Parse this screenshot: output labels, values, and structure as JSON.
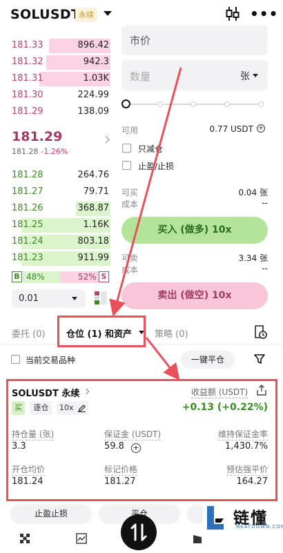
{
  "header": {
    "title": "SOLUSDT",
    "tag": "永续",
    "menu_icon": "more-icon",
    "chart_icon": "candlestick-icon"
  },
  "orderbook": {
    "asks": [
      {
        "price": "181.33",
        "qty": "896.42",
        "depth": 0.62
      },
      {
        "price": "181.32",
        "qty": "942.3",
        "depth": 0.65
      },
      {
        "price": "181.31",
        "qty": "1.03K",
        "depth": 0.72
      },
      {
        "price": "181.30",
        "qty": "224.99",
        "depth": 0.0
      },
      {
        "price": "181.29",
        "qty": "138.09",
        "depth": 0.0
      }
    ],
    "last_price": "181.29",
    "mark_price": "181.28",
    "change": "-1.26%",
    "bids": [
      {
        "price": "181.28",
        "qty": "264.76",
        "depth": 0.0
      },
      {
        "price": "181.27",
        "qty": "79.71",
        "depth": 0.0
      },
      {
        "price": "181.26",
        "qty": "368.87",
        "depth": 0.35
      },
      {
        "price": "181.25",
        "qty": "1.16K",
        "depth": 0.9
      },
      {
        "price": "181.24",
        "qty": "803.18",
        "depth": 0.9
      },
      {
        "price": "181.23",
        "qty": "911.99",
        "depth": 0.9
      }
    ],
    "buy_label": "B",
    "buy_ratio": "48%",
    "sell_ratio": "52%",
    "sell_label": "S",
    "precision": "0.01"
  },
  "form": {
    "order_type": "市价",
    "qty_placeholder": "数量",
    "qty_unit": "张",
    "slider_percent": 0,
    "available_label": "可用",
    "available_value": "0.77 USDT",
    "reduce_only": "只减仓",
    "tp_sl": "止盈/止损",
    "can_buy_label": "可买",
    "can_buy_value": "0.04 张",
    "cost_label": "成本",
    "cost_value": "--",
    "buy_button": "买入 (做多) 10x",
    "can_sell_label": "可卖",
    "can_sell_value": "3.34 张",
    "cost2_label": "成本",
    "cost2_value": "--",
    "sell_button": "卖出 (做空) 10x"
  },
  "tabs": {
    "orders": "委托 (0)",
    "positions": "仓位 (1) 和资产",
    "strategy": "策略 (0)"
  },
  "filter": {
    "current_only": "当前交易品种",
    "close_all": "一键平仓"
  },
  "position": {
    "title": "SOLUSDT 永续",
    "pnl_label": "收益额 (USDT)",
    "pnl_value": "+0.13 (+0.22%)",
    "side": "买",
    "margin_mode": "逐仓",
    "leverage": "10x",
    "size_label": "持仓量 (张)",
    "size_value": "3.3",
    "margin_label": "保证金 (USDT)",
    "margin_value": "59.8",
    "mmr_label": "维持保证金率",
    "mmr_value": "1,430.7%",
    "entry_label": "开仓均价",
    "entry_value": "181.24",
    "mark_label": "标记价格",
    "mark_value": "181.27",
    "liq_label": "预估强平价",
    "liq_value": "164.27"
  },
  "actions": {
    "tpsl": "止盈止损",
    "close": "平仓"
  },
  "watermark": {
    "text": "链懂",
    "sub": "NEATDOWN.COM"
  },
  "colors": {
    "ask": "#b24569",
    "bid": "#3c8a24",
    "annotation": "#e8505b"
  }
}
